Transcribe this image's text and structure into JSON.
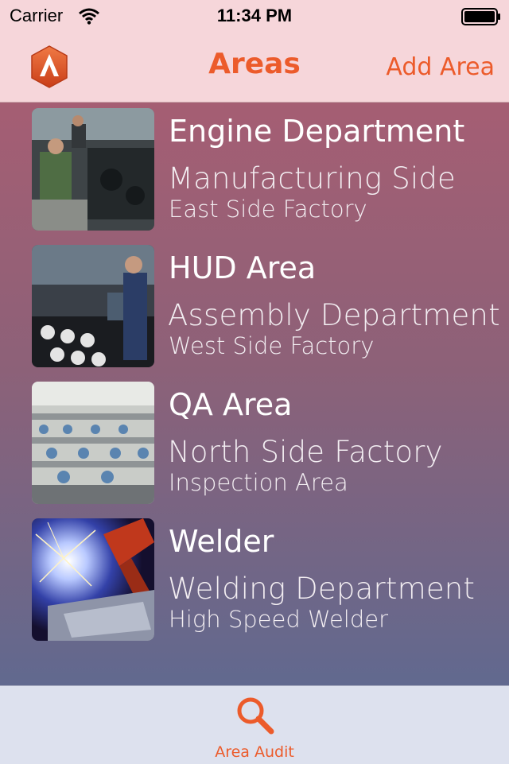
{
  "status_bar": {
    "carrier": "Carrier",
    "time": "11:34 PM",
    "wifi_icon": "wifi-icon",
    "battery_icon": "battery-icon"
  },
  "nav": {
    "title": "Areas",
    "add_button": "Add Area",
    "logo_icon": "app-logo",
    "accent_color": "#ec5b2b"
  },
  "areas": [
    {
      "name": "Engine Department",
      "line1": "Manufacturing Side",
      "line2": "East Side Factory",
      "thumbnail": "engine-assembly-line-photo"
    },
    {
      "name": "HUD Area",
      "line1": "Assembly Department",
      "line2": "West Side Factory",
      "thumbnail": "hud-assembly-worker-photo"
    },
    {
      "name": "QA Area",
      "line1": "North Side Factory",
      "line2": "Inspection Area",
      "thumbnail": "inspection-floor-photo"
    },
    {
      "name": "Welder",
      "line1": "Welding Department",
      "line2": "High Speed Welder",
      "thumbnail": "robot-welding-sparks-photo"
    }
  ],
  "tab_bar": {
    "items": [
      {
        "label": "Area Audit",
        "icon": "search-icon"
      }
    ]
  }
}
